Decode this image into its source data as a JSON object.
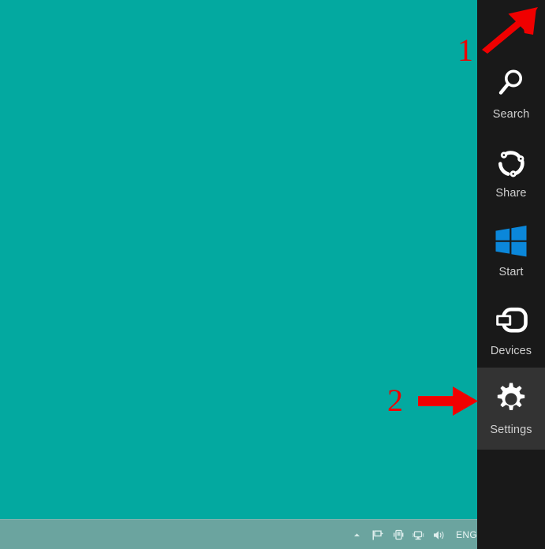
{
  "desktop": {
    "background_color": "#03a9a0",
    "name": "windows-8-desktop"
  },
  "taskbar": {
    "background_color": "#6ba49f",
    "language_indicator": "ENG",
    "tray_icons": [
      {
        "name": "show-hidden-icons-chevron",
        "glyph": "chevron-up-icon"
      },
      {
        "name": "action-center-flag",
        "glyph": "flag-icon"
      },
      {
        "name": "removable-media",
        "glyph": "usb-device-icon"
      },
      {
        "name": "network-status",
        "glyph": "network-monitor-icon"
      },
      {
        "name": "volume",
        "glyph": "speaker-icon"
      }
    ]
  },
  "charms_bar": {
    "background_color": "#191919",
    "active_background_color": "#333333",
    "items": [
      {
        "label": "Search",
        "icon": "magnifier-icon",
        "active": false
      },
      {
        "label": "Share",
        "icon": "share-circle-icon",
        "active": false
      },
      {
        "label": "Start",
        "icon": "windows-logo-icon",
        "active": false
      },
      {
        "label": "Devices",
        "icon": "devices-icon",
        "active": false
      },
      {
        "label": "Settings",
        "icon": "gear-icon",
        "active": true
      }
    ]
  },
  "annotations": {
    "color": "#f00000",
    "markers": [
      {
        "number": "1",
        "arrow": "arrow-up-right",
        "target": "charms-bar-top-right-corner"
      },
      {
        "number": "2",
        "arrow": "arrow-right",
        "target": "charm-item-settings"
      }
    ]
  },
  "icon_colors": {
    "windows_logo": "#0b87da",
    "charm_icon": "#ffffff",
    "charm_label": "#cfcfcf"
  }
}
